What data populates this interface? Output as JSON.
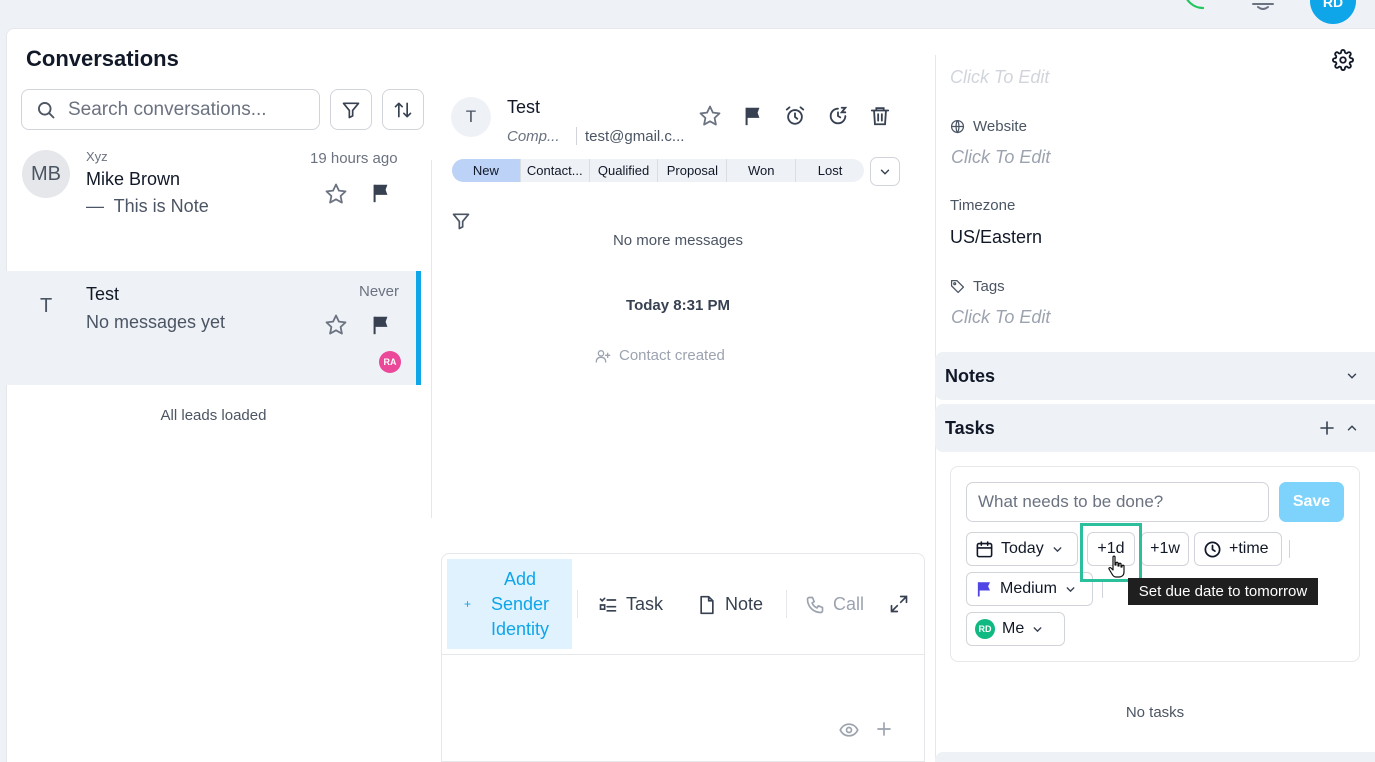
{
  "topbar": {
    "user_initials": "RD"
  },
  "page": {
    "title": "Conversations"
  },
  "search": {
    "placeholder": "Search conversations..."
  },
  "conversations": [
    {
      "initials": "MB",
      "company": "Xyz",
      "name": "Mike Brown",
      "preview": "—  This is Note",
      "time": "19 hours ago"
    },
    {
      "initials": "T",
      "name": "Test",
      "preview": "No messages yet",
      "time": "Never",
      "assignee": "RA"
    }
  ],
  "list_footer": "All leads loaded",
  "contact": {
    "initial": "T",
    "name": "Test",
    "company": "Comp...",
    "email": "test@gmail.c...",
    "stages": [
      "New",
      "Contact...",
      "Qualified",
      "Proposal",
      "Won",
      "Lost"
    ],
    "active_stage": "New"
  },
  "messages": {
    "end_notice": "No more messages",
    "date_divider": "Today 8:31 PM",
    "event": "Contact created"
  },
  "composer": {
    "sender_identity": "Add Sender Identity",
    "sender_plus": "+",
    "task": "Task",
    "note": "Note",
    "call": "Call"
  },
  "details": {
    "truncated_top": "Click To Edit",
    "website_label": "Website",
    "website_value": "Click To Edit",
    "timezone_label": "Timezone",
    "timezone_value": "US/Eastern",
    "tags_label": "Tags",
    "tags_value": "Click To Edit"
  },
  "notes_section": {
    "title": "Notes"
  },
  "tasks_section": {
    "title": "Tasks",
    "input_placeholder": "What needs to be done?",
    "save": "Save",
    "due_today": "Today",
    "plus_day": "+1d",
    "plus_week": "+1w",
    "plus_time": "+time",
    "priority": "Medium",
    "assignee_initials": "RD",
    "assignee": "Me",
    "tooltip": "Set due date to tomorrow",
    "empty": "No tasks"
  },
  "colors": {
    "accent": "#0ea5e9",
    "highlight": "#2bbf9c",
    "priority_flag": "#4f46e5",
    "green_phone": "#22c55e",
    "assignee_badge": "#ec4899"
  }
}
